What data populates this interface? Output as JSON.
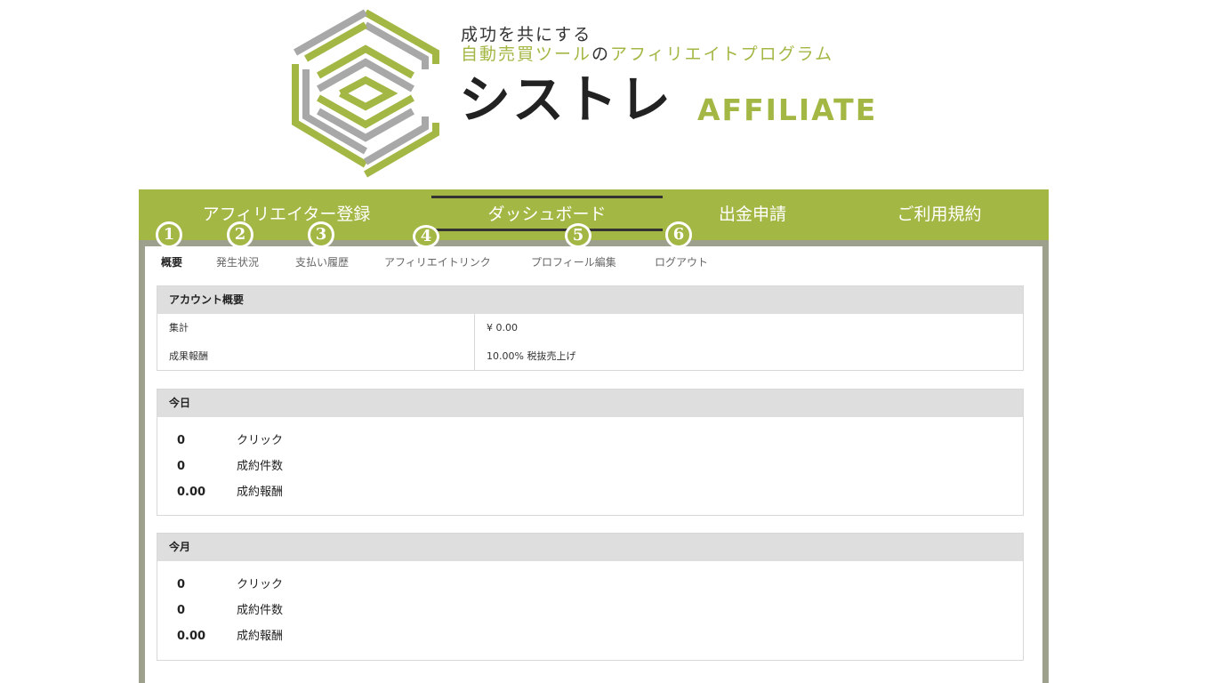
{
  "header": {
    "tagline_line1": "成功を共にする",
    "tagline_line2_green": "自動売買ツール",
    "tagline_line2_mid": "の",
    "tagline_line2_end": "アフィリエイトプログラム",
    "brand": "シストレ",
    "brand_sub": "AFFILIATE"
  },
  "main_nav": [
    {
      "label": "アフィリエイター登録"
    },
    {
      "label": "ダッシュボード"
    },
    {
      "label": "出金申請"
    },
    {
      "label": "ご利用規約"
    }
  ],
  "badges": [
    "1",
    "2",
    "3",
    "4",
    "5",
    "6"
  ],
  "sub_nav": [
    {
      "label": "概要"
    },
    {
      "label": "発生状況"
    },
    {
      "label": "支払い履歴"
    },
    {
      "label": "アフィリエイトリンク"
    },
    {
      "label": "プロフィール編集"
    },
    {
      "label": "ログアウト"
    }
  ],
  "account": {
    "title": "アカウント概要",
    "rows": [
      {
        "key": "集計",
        "value": "¥ 0.00"
      },
      {
        "key": "成果報酬",
        "value": "10.00% 税抜売上げ"
      }
    ]
  },
  "today": {
    "title": "今日",
    "stats": [
      {
        "value": "0",
        "label": "クリック"
      },
      {
        "value": "0",
        "label": "成約件数"
      },
      {
        "value": "0.00",
        "label": "成約報酬"
      }
    ]
  },
  "month": {
    "title": "今月",
    "stats": [
      {
        "value": "0",
        "label": "クリック"
      },
      {
        "value": "0",
        "label": "成約件数"
      },
      {
        "value": "0.00",
        "label": "成約報酬"
      }
    ]
  },
  "colors": {
    "accent_green": "#a3b744",
    "frame_gray": "#9ea08e",
    "panel_head": "#dedede"
  }
}
